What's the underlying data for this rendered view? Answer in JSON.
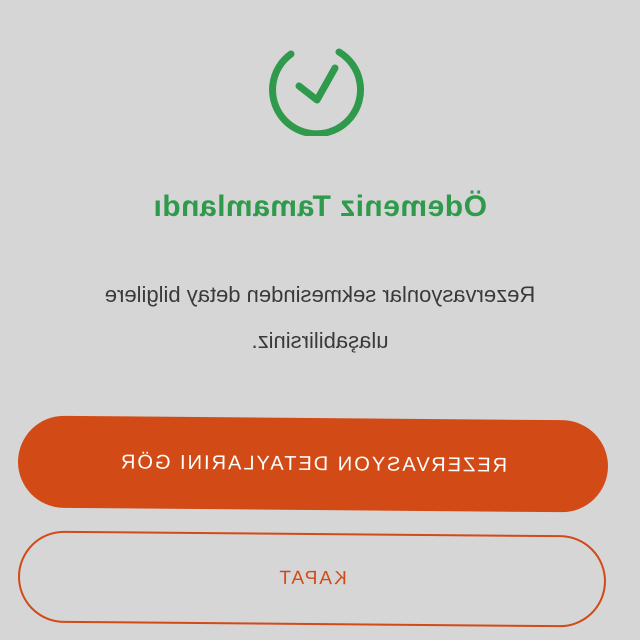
{
  "colors": {
    "background": "#d6d6d6",
    "success_green": "#2f9a4c",
    "accent_orange": "#d24a16",
    "body_text": "#3a3a3a"
  },
  "icon": "check-circle-icon",
  "title": "Ödemeniz Tamamlandı",
  "message": "Rezervasyonlar sekmesinden detay bilgilere ulaşabilirsiniz.",
  "actions": {
    "primary_label": "REZERVASYON DETAYLARINI GÖR",
    "secondary_label": "KAPAT"
  }
}
